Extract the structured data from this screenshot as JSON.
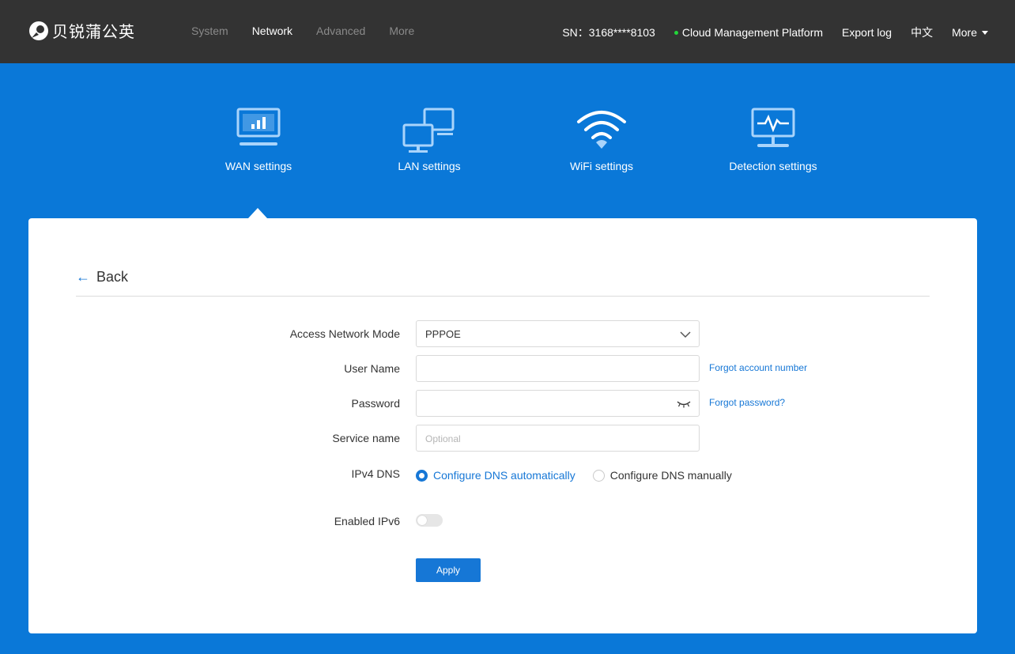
{
  "brand": {
    "name": "贝锐蒲公英"
  },
  "nav": {
    "items": [
      {
        "label": "System",
        "active": false
      },
      {
        "label": "Network",
        "active": true
      },
      {
        "label": "Advanced",
        "active": false
      },
      {
        "label": "More",
        "active": false
      }
    ]
  },
  "header": {
    "sn": "SN：3168****8103",
    "cloud": "Cloud Management Platform",
    "cloud_status_color": "#22d63a",
    "export_log": "Export log",
    "language": "中文",
    "more": "More"
  },
  "tabs": [
    {
      "label": "WAN settings",
      "icon": "monitor-chart-icon",
      "active": true
    },
    {
      "label": "LAN settings",
      "icon": "network-computers-icon",
      "active": false
    },
    {
      "label": "WiFi settings",
      "icon": "wifi-icon",
      "active": false
    },
    {
      "label": "Detection settings",
      "icon": "monitor-pulse-icon",
      "active": false
    }
  ],
  "panel": {
    "back": "Back",
    "form": {
      "access_mode": {
        "label": "Access Network Mode",
        "value": "PPPOE"
      },
      "username": {
        "label": "User Name",
        "value": "",
        "link": "Forgot account number"
      },
      "password": {
        "label": "Password",
        "value": "",
        "link": "Forgot password?"
      },
      "service": {
        "label": "Service name",
        "placeholder": "Optional"
      },
      "ipv4_dns": {
        "label": "IPv4 DNS",
        "options": [
          "Configure DNS automatically",
          "Configure DNS manually"
        ],
        "selected": "Configure DNS automatically"
      },
      "ipv6": {
        "label": "Enabled IPv6",
        "enabled": false
      },
      "apply": "Apply"
    }
  },
  "colors": {
    "accent": "#1677d6",
    "banner": "#0a78d8",
    "topbar": "#333333"
  }
}
